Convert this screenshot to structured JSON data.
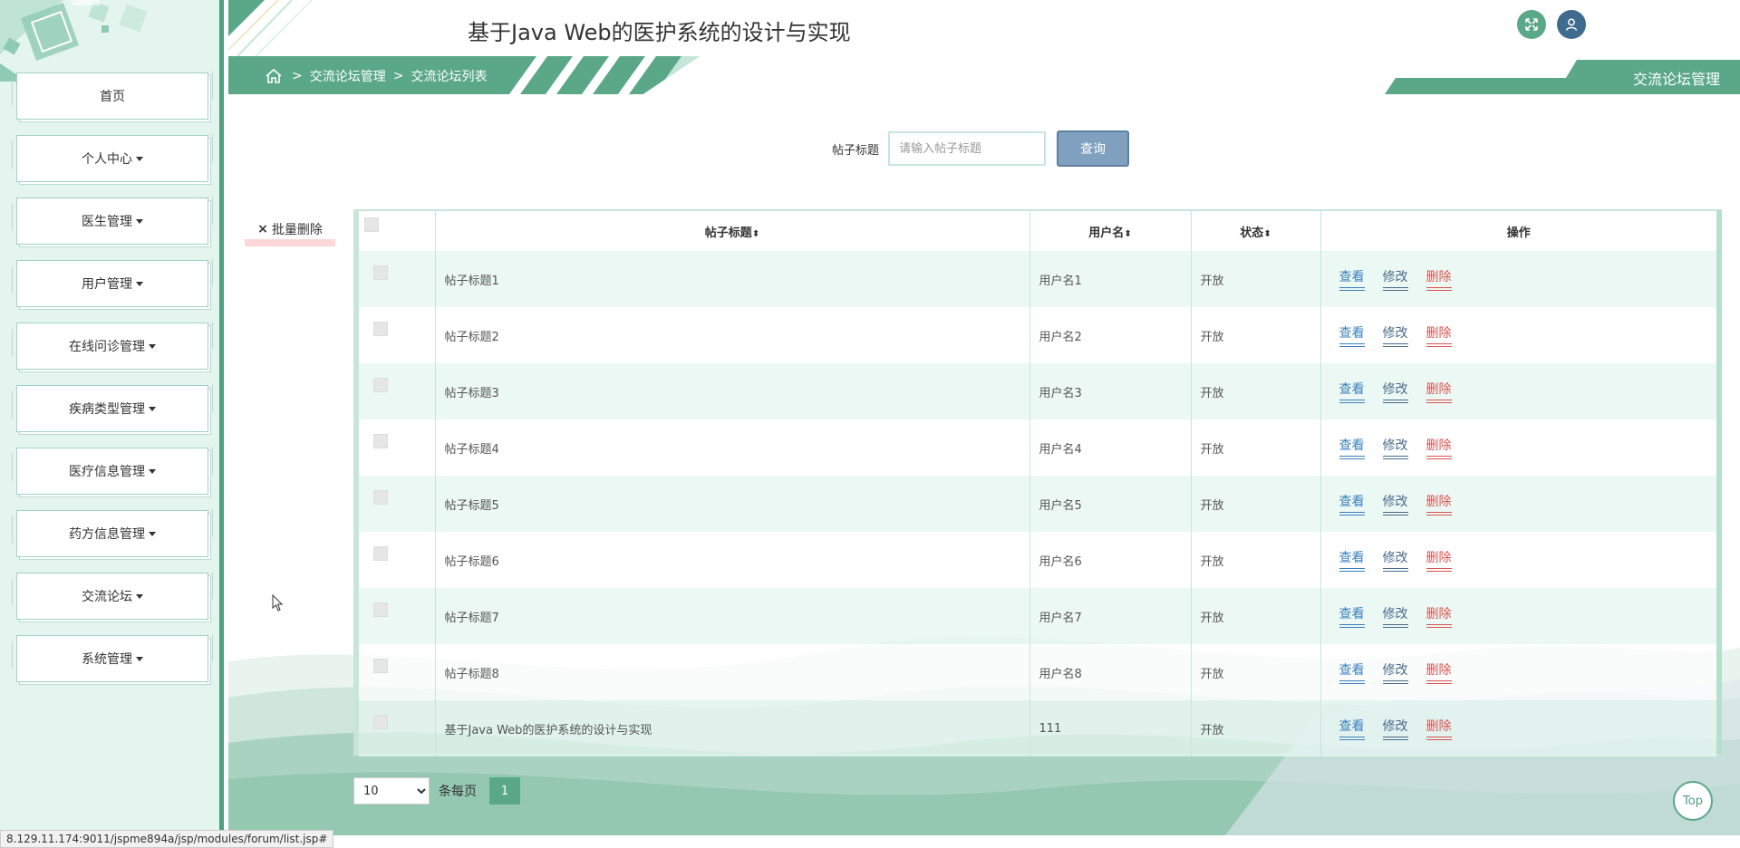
{
  "header": {
    "title": "基于Java Web的医护系统的设计与实现",
    "fullscreen_icon": "expand-icon",
    "user_icon": "user-icon"
  },
  "sidebar": {
    "items": [
      {
        "label": "首页",
        "dropdown": false
      },
      {
        "label": "个人中心",
        "dropdown": true
      },
      {
        "label": "医生管理",
        "dropdown": true
      },
      {
        "label": "用户管理",
        "dropdown": true
      },
      {
        "label": "在线问诊管理",
        "dropdown": true
      },
      {
        "label": "疾病类型管理",
        "dropdown": true
      },
      {
        "label": "医疗信息管理",
        "dropdown": true
      },
      {
        "label": "药方信息管理",
        "dropdown": true
      },
      {
        "label": "交流论坛",
        "dropdown": true
      },
      {
        "label": "系统管理",
        "dropdown": true
      }
    ]
  },
  "breadcrumb": {
    "home_icon": "home-icon",
    "level1": "交流论坛管理",
    "level2": "交流论坛列表",
    "separator": ">"
  },
  "right_tag": {
    "label": "交流论坛管理"
  },
  "search": {
    "label": "帖子标题",
    "placeholder": "请输入帖子标题",
    "value": "",
    "button": "查询"
  },
  "batch_delete": {
    "label": "批量删除",
    "icon": "×"
  },
  "table": {
    "headers": {
      "title": "帖子标题",
      "username": "用户名",
      "status": "状态",
      "actions": "操作"
    },
    "sort_icon": "⬍",
    "action_labels": {
      "view": "查看",
      "edit": "修改",
      "delete": "删除"
    },
    "rows": [
      {
        "title": "帖子标题1",
        "username": "用户名1",
        "status": "开放"
      },
      {
        "title": "帖子标题2",
        "username": "用户名2",
        "status": "开放"
      },
      {
        "title": "帖子标题3",
        "username": "用户名3",
        "status": "开放"
      },
      {
        "title": "帖子标题4",
        "username": "用户名4",
        "status": "开放"
      },
      {
        "title": "帖子标题5",
        "username": "用户名5",
        "status": "开放"
      },
      {
        "title": "帖子标题6",
        "username": "用户名6",
        "status": "开放"
      },
      {
        "title": "帖子标题7",
        "username": "用户名7",
        "status": "开放"
      },
      {
        "title": "帖子标题8",
        "username": "用户名8",
        "status": "开放"
      },
      {
        "title": "基于Java Web的医护系统的设计与实现",
        "username": "111",
        "status": "开放"
      }
    ]
  },
  "pagination": {
    "page_size": "10",
    "page_size_options": [
      "10"
    ],
    "per_page_label": "条每页",
    "current_page": "1"
  },
  "top_button": "Top",
  "status_url": "8.129.11.174:9011/jspme894a/jsp/modules/forum/list.jsp#",
  "colors": {
    "primary": "#5aa888",
    "sidebar_bg": "#e4f4ee",
    "search_button": "#7fa0bf",
    "view": "#3a7fbf",
    "edit": "#4a6a8a",
    "delete": "#d9534f"
  }
}
